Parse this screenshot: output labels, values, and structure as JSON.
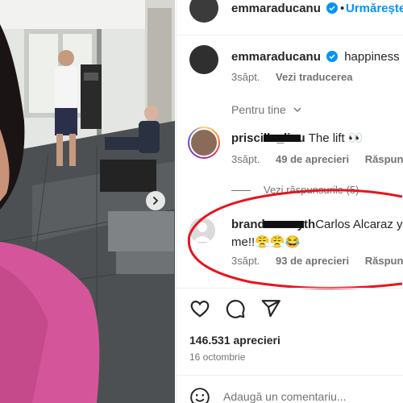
{
  "post": {
    "author": "emmaraducanu",
    "verified_icon": "verified-badge-icon",
    "follow_label": "Urmărește",
    "dot": "•",
    "caption_text": "happiness do",
    "caption_time": "3săpt.",
    "translate_label": "Vezi traducerea",
    "sort_label": "Pentru tine",
    "accent_color": "#0095f6",
    "annotation_color": "#e8141e"
  },
  "comments": [
    {
      "username": "priscilla_liou",
      "text": "The lift 👀",
      "time": "3săpt.",
      "likes": "49 de aprecieri",
      "reply_label": "Răspunde",
      "replies_label": "Vezi răspunsurile (5)"
    },
    {
      "username": "brandonsmyth",
      "text_line1": "Carlos Alcaraz you",
      "text_line2": "me!!😤😤😂",
      "time": "3săpt.",
      "likes": "93 de aprecieri",
      "reply_label": "Răspunde"
    }
  ],
  "actions": {
    "like_icon": "heart-icon",
    "comment_icon": "comment-bubble-icon",
    "share_icon": "share-icon"
  },
  "stats": {
    "likes": "146.531 aprecieri",
    "date": "16 octombrie"
  },
  "composer": {
    "placeholder": "Adaugă un comentariu..."
  }
}
